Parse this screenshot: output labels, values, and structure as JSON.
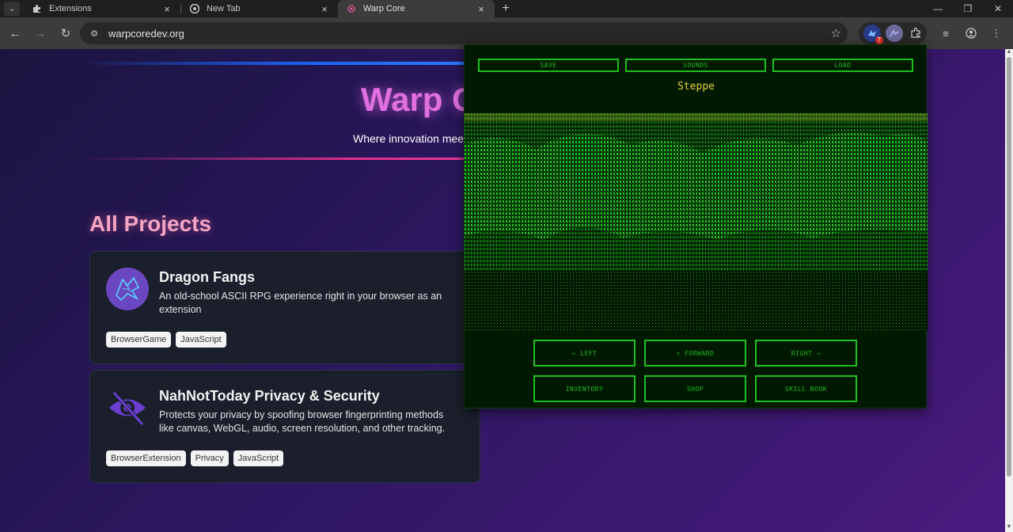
{
  "tabs": [
    {
      "title": "Extensions",
      "icon": "puzzle-icon",
      "active": false
    },
    {
      "title": "New Tab",
      "icon": "chrome-icon",
      "active": false
    },
    {
      "title": "Warp Core",
      "icon": "gear-icon",
      "active": true
    }
  ],
  "toolbar": {
    "url": "warpcoredev.org",
    "extension_badge": "7"
  },
  "hero": {
    "title": "Warp C",
    "tagline": "Where innovation meets"
  },
  "projects_section": {
    "title": "All Projects",
    "cards": [
      {
        "name": "Dragon Fangs",
        "description": "An old-school ASCII RPG experience right in your browser as an extension",
        "tags": [
          "BrowserGame",
          "JavaScript"
        ],
        "icon": "dragon-icon"
      },
      {
        "name": "NahNotToday Privacy & Security",
        "description": "Protects your privacy by spoofing browser fingerprinting methods like canvas, WebGL, audio, screen resolution, and other tracking.",
        "tags": [
          "BrowserExtension",
          "Privacy",
          "JavaScript"
        ],
        "icon": "eye-off-icon"
      }
    ]
  },
  "popup": {
    "top_buttons": [
      "SAVE",
      "SOUNDS",
      "LOAD"
    ],
    "location": "Steppe",
    "nav_buttons": [
      "← LEFT",
      "↑ FORWARD",
      "RIGHT →"
    ],
    "action_buttons": [
      "INVENTORY",
      "SHOP",
      "SKILL BOOK"
    ]
  },
  "colors": {
    "popup_green": "#1fbf1f",
    "location_yellow": "#e6d23a",
    "hero_pink": "#e070e0"
  }
}
